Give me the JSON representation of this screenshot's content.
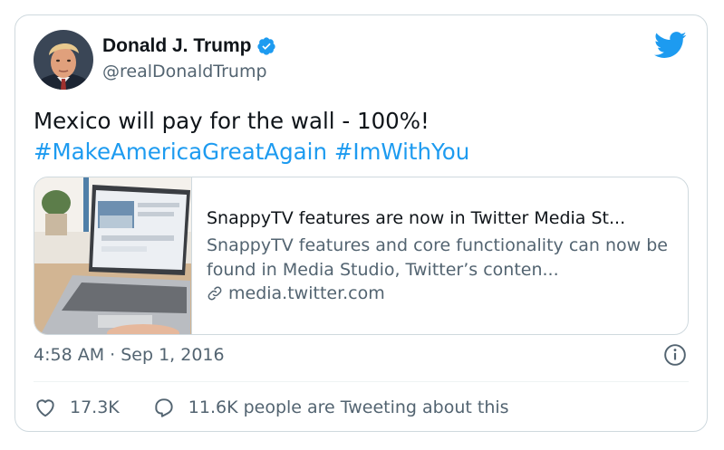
{
  "tweet": {
    "author": {
      "name": "Donald J. Trump",
      "handle": "@realDonaldTrump"
    },
    "text_main": "Mexico will pay for the wall - 100%!",
    "hashtags": [
      "#MakeAmericaGreatAgain",
      "#ImWithYou"
    ],
    "link_card": {
      "title": "SnappyTV features are now in Twitter Media St...",
      "description": "SnappyTV features and core functionality can now be found in Media Studio, Twitter’s conten...",
      "domain": "media.twitter.com"
    },
    "timestamp": "4:58 AM · Sep 1, 2016",
    "likes": "17.3K",
    "conversation": "11.6K people are Tweeting about this"
  },
  "colors": {
    "accent": "#1d9bf0",
    "text_secondary": "#536471",
    "border": "#cfd9de"
  },
  "icons": [
    "verified-badge-icon",
    "twitter-bird-icon",
    "link-icon",
    "info-icon",
    "heart-icon",
    "reply-bubble-icon"
  ]
}
